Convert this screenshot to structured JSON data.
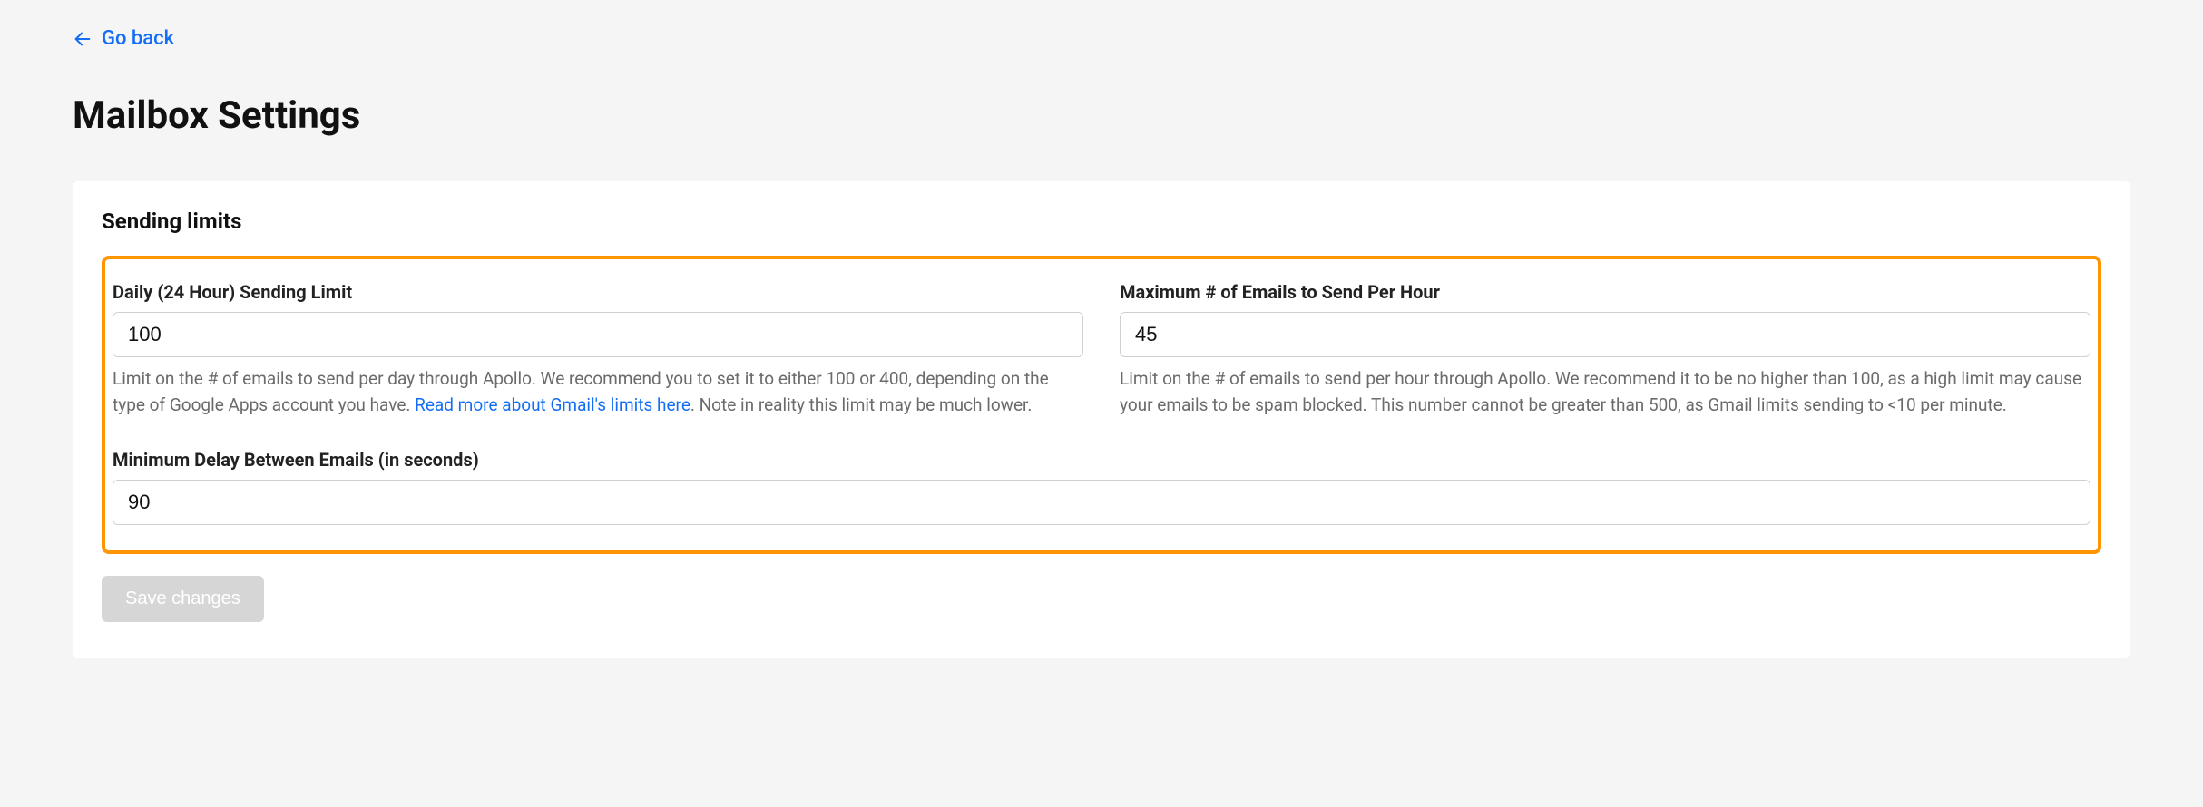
{
  "nav": {
    "back_label": "Go back"
  },
  "page": {
    "title": "Mailbox Settings"
  },
  "section": {
    "title": "Sending limits"
  },
  "fields": {
    "daily": {
      "label": "Daily (24 Hour) Sending Limit",
      "value": "100",
      "helper_pre": "Limit on the # of emails to send per day through Apollo. We recommend you to set it to either 100 or 400, depending on the type of Google Apps account you have. ",
      "helper_link": "Read more about Gmail's limits here",
      "helper_post": ". Note in reality this limit may be much lower."
    },
    "hourly": {
      "label": "Maximum # of Emails to Send Per Hour",
      "value": "45",
      "helper": "Limit on the # of emails to send per hour through Apollo. We recommend it to be no higher than 100, as a high limit may cause your emails to be spam blocked. This number cannot be greater than 500, as Gmail limits sending to <10 per minute."
    },
    "delay": {
      "label": "Minimum Delay Between Emails (in seconds)",
      "value": "90"
    }
  },
  "actions": {
    "save_label": "Save changes"
  },
  "colors": {
    "link": "#146ef5",
    "highlight_border": "#ff9500"
  }
}
